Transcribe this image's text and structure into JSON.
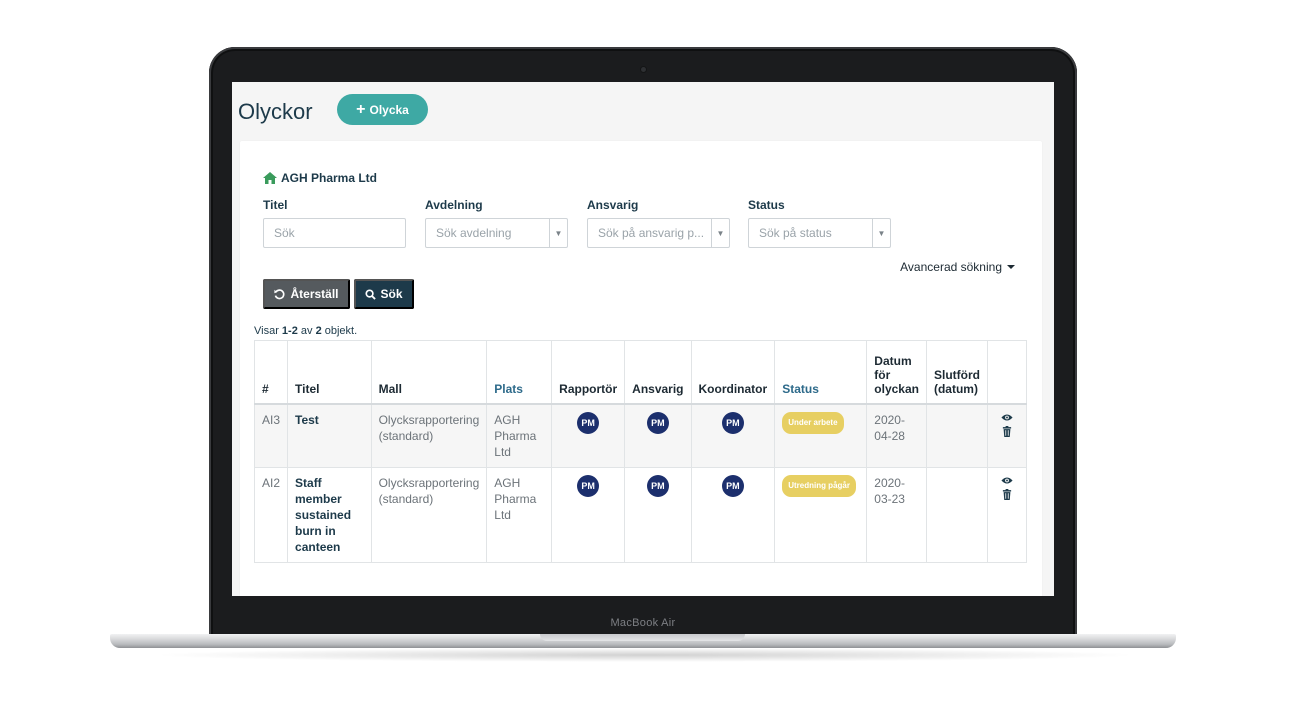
{
  "device": {
    "label": "MacBook Air"
  },
  "page": {
    "title": "Olyckor",
    "add_button": "Olycka"
  },
  "filters": {
    "company": "AGH Pharma Ltd",
    "fields": [
      {
        "label": "Titel",
        "placeholder": "Sök"
      },
      {
        "label": "Avdelning",
        "placeholder": "Sök avdelning"
      },
      {
        "label": "Ansvarig",
        "placeholder": "Sök på ansvarig p..."
      },
      {
        "label": "Status",
        "placeholder": "Sök på status"
      }
    ],
    "advanced_search": "Avancerad sökning",
    "reset_button": "Återställ",
    "search_button": "Sök"
  },
  "summary": {
    "prefix": "Visar ",
    "range": "1-2",
    "middle": " av ",
    "total": "2",
    "suffix": " objekt."
  },
  "table": {
    "columns": [
      "#",
      "Titel",
      "Mall",
      "Plats",
      "Rapportör",
      "Ansvarig",
      "Koordinator",
      "Status",
      "Datum för olyckan",
      "Slutförd (datum)",
      ""
    ],
    "rows": [
      {
        "id": "AI3",
        "title": "Test",
        "template": "Olycksrapportering (standard)",
        "location": "AGH Pharma Ltd",
        "reporter": "PM",
        "responsible": "PM",
        "coordinator": "PM",
        "status": "Under arbete",
        "date": "2020-04-28",
        "completed": ""
      },
      {
        "id": "AI2",
        "title": "Staff member sustained burn in canteen",
        "template": "Olycksrapportering (standard)",
        "location": "AGH Pharma Ltd",
        "reporter": "PM",
        "responsible": "PM",
        "coordinator": "PM",
        "status": "Utredning pågår",
        "date": "2020-03-23",
        "completed": ""
      }
    ]
  },
  "colors": {
    "accent": "#3ea9a4",
    "primary": "#1d3a4a",
    "avatar": "#1c2f6d",
    "badge": "#e7cf62"
  }
}
